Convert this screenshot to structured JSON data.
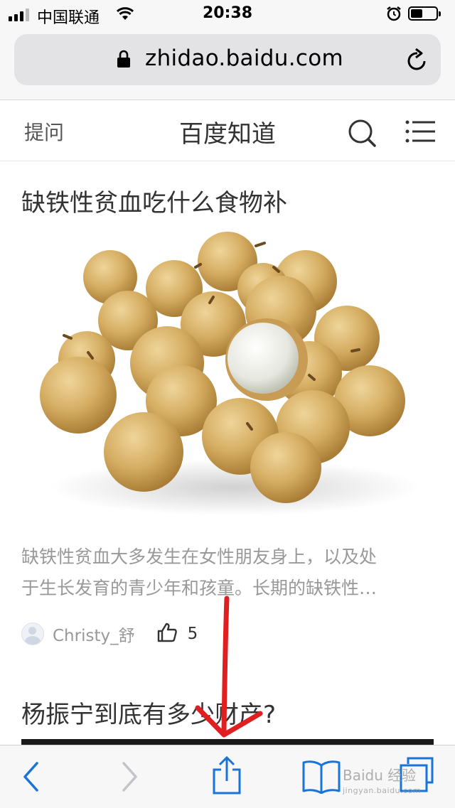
{
  "status_bar": {
    "carrier": "中国联通",
    "time": "20:38"
  },
  "browser": {
    "url": "zhidao.baidu.com"
  },
  "header": {
    "ask_label": "提问",
    "brand": "百度知道"
  },
  "articles": [
    {
      "title": "缺铁性贫血吃什么食物补",
      "description_lines": [
        "缺铁性贫血大多发生在女性朋友身上，以及处",
        "于生长发育的青少年和孩童。长期的缺铁性…"
      ],
      "author": "Christy_舒",
      "likes": "5"
    },
    {
      "title": "杨振宁到底有多少财产?"
    }
  ],
  "watermark": {
    "text": "Baidu 经验",
    "sub": "jingyan.baidu.com"
  },
  "colors": {
    "annotation_arrow": "#e02020",
    "ios_blue": "#1a73d9"
  }
}
